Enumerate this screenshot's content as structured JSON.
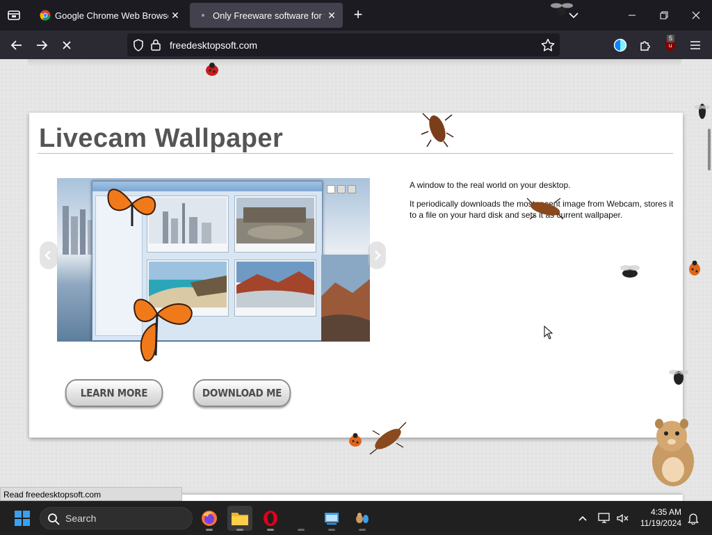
{
  "browser": {
    "tabs": [
      {
        "title": "Google Chrome Web Browser",
        "active": false
      },
      {
        "title": "Only Freeware software for you",
        "active": true
      }
    ],
    "url": "freedesktopsoft.com",
    "extension_badge": "5"
  },
  "page": {
    "title": "Livecam Wallpaper",
    "description": [
      "A window to the real world on your desktop.",
      "It periodically downloads the most recent image from Webcam, stores it to a file on your hard disk and sets it as current wallpaper."
    ],
    "buttons": {
      "learn_more": "LEARN MORE",
      "download_me": "DOWNLOAD ME"
    }
  },
  "status_bar": "Read freedesktopsoft.com",
  "taskbar": {
    "search_placeholder": "Search",
    "time": "4:35 AM",
    "date": "11/19/2024"
  },
  "colors": {
    "chrome_dark": "#1c1b22",
    "toolbar": "#2b2a33",
    "active_tab": "#42414d",
    "page_bg": "#e6e6e6",
    "heading": "#555555"
  }
}
